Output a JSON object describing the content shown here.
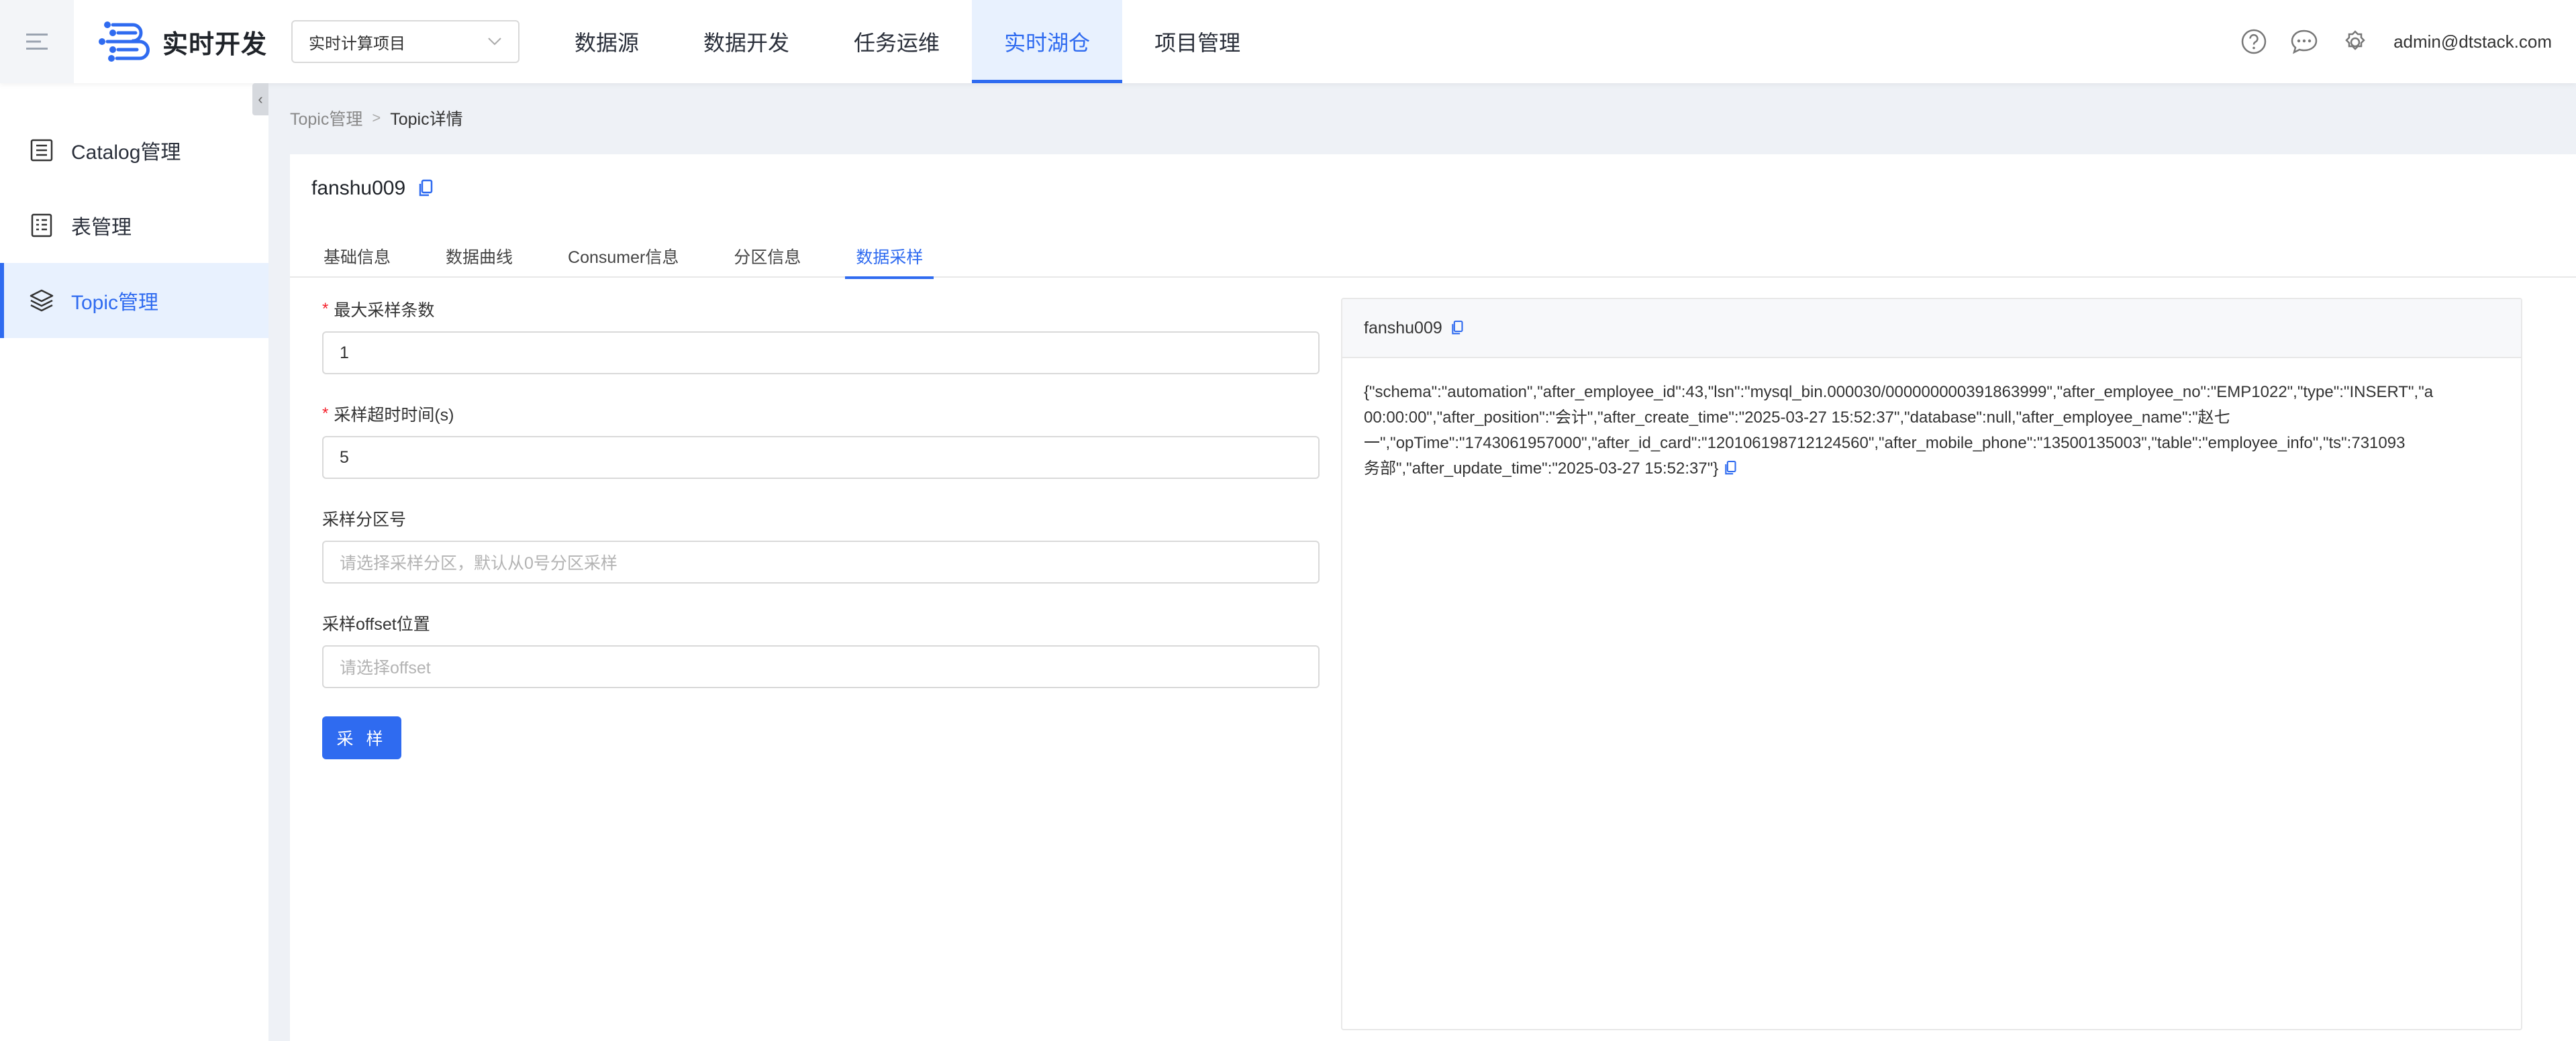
{
  "header": {
    "app_title": "实时开发",
    "project_select": "实时计算项目",
    "nav": [
      "数据源",
      "数据开发",
      "任务运维",
      "实时湖仓",
      "项目管理"
    ],
    "active_nav": 3,
    "user": "admin@dtstack.com"
  },
  "sidebar": {
    "items": [
      {
        "label": "Catalog管理",
        "icon": "catalog-icon"
      },
      {
        "label": "表管理",
        "icon": "table-icon"
      },
      {
        "label": "Topic管理",
        "icon": "layers-icon"
      }
    ],
    "active": 2
  },
  "breadcrumb": {
    "parent": "Topic管理",
    "current": "Topic详情"
  },
  "topic": {
    "name": "fanshu009"
  },
  "tabs": [
    "基础信息",
    "数据曲线",
    "Consumer信息",
    "分区信息",
    "数据采样"
  ],
  "form": {
    "max_count_label": "最大采样条数",
    "max_count_value": "1",
    "timeout_label": "采样超时时间(s)",
    "timeout_value": "5",
    "partition_label": "采样分区号",
    "partition_placeholder": "请选择采样分区，默认从0号分区采样",
    "offset_label": "采样offset位置",
    "offset_placeholder": "请选择offset",
    "submit": "采 样"
  },
  "result": {
    "title": "fanshu009",
    "lines": [
      "{\"schema\":\"automation\",\"after_employee_id\":43,\"lsn\":\"mysql_bin.000030/000000000391863999\",\"after_employee_no\":\"EMP1022\",\"type\":\"INSERT\",\"a",
      "00:00:00\",\"after_position\":\"会计\",\"after_create_time\":\"2025-03-27 15:52:37\",\"database\":null,\"after_employee_name\":\"赵七",
      "一\",\"opTime\":\"1743061957000\",\"after_id_card\":\"120106198712124560\",\"after_mobile_phone\":\"13500135003\",\"table\":\"employee_info\",\"ts\":731093",
      "务部\",\"after_update_time\":\"2025-03-27 15:52:37\"}"
    ]
  },
  "colors": {
    "accent": "#2f6bf0",
    "required": "#f5222d"
  }
}
